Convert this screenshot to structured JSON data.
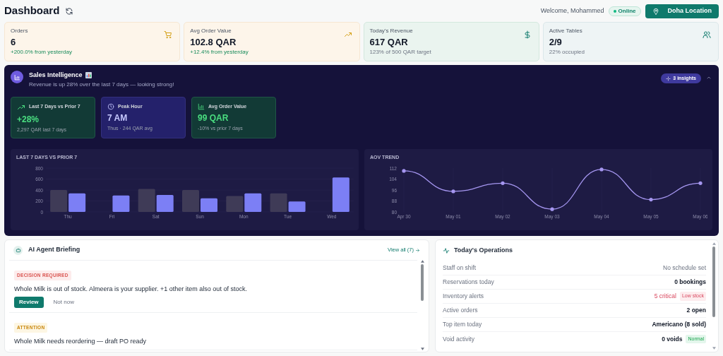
{
  "header": {
    "title": "Dashboard",
    "welcome": "Welcome, Mohammed",
    "status": {
      "label": "Online",
      "online": true
    },
    "location_button": "Doha Location"
  },
  "kpis": [
    {
      "label": "Orders",
      "value": "6",
      "note": "+200.0% from yesterday"
    },
    {
      "label": "Avg Order Value",
      "value": "102.8 QAR",
      "note": "+12.4% from yesterday"
    },
    {
      "label": "Today's Revenue",
      "value": "617 QAR",
      "note": "123% of 500 QAR target"
    },
    {
      "label": "Active Tables",
      "value": "2/9",
      "note": "22% occupied"
    }
  ],
  "sales_intelligence": {
    "title": "Sales Intelligence",
    "subtitle": "Revenue is up 28% over the last 7 days — looking strong!",
    "insights_badge": "3 insights",
    "expanded": true,
    "stats": [
      {
        "label": "Last 7 Days vs Prior 7",
        "value": "+28%",
        "note": "2,297 QAR last 7 days"
      },
      {
        "label": "Peak Hour",
        "value": "7 AM",
        "note": "Thus · 244 QAR avg"
      },
      {
        "label": "Avg Order Value",
        "value": "99 QAR",
        "note": "-10% vs prior 7 days"
      }
    ],
    "bar_chart": {
      "chart_data": {
        "type": "bar",
        "title": "LAST 7 DAYS VS PRIOR 7",
        "categories": [
          "Thu",
          "Fri",
          "Sat",
          "Sun",
          "Mon",
          "Tue",
          "Wed"
        ],
        "ylim": [
          0,
          800
        ],
        "yticks": [
          0,
          200,
          400,
          600,
          800
        ],
        "series": [
          {
            "color": "#3f3b57",
            "values": [
              400,
              null,
              420,
              400,
              290,
              340,
              null
            ]
          },
          {
            "color": "#7c7ff5",
            "values": [
              340,
              300,
              310,
              250,
              340,
              190,
              630
            ]
          }
        ]
      }
    },
    "line_chart": {
      "chart_data": {
        "type": "line",
        "title": "AOV TREND",
        "categories": [
          "Apr 30",
          "May 01",
          "May 02",
          "May 03",
          "May 04",
          "May 05",
          "May 06"
        ],
        "ylim": [
          80,
          112
        ],
        "yticks": [
          80,
          88,
          96,
          104,
          112
        ],
        "series": [
          {
            "color": "#a596f0",
            "values": [
              110,
              95,
              101,
              82,
              111,
              89,
              101
            ]
          }
        ]
      }
    }
  },
  "briefing": {
    "title": "AI Agent Briefing",
    "view_all": "View all (7)",
    "items": [
      {
        "tag": "DECISION REQUIRED",
        "kind": "decision",
        "text": "Whole Milk is out of stock. Almeera is your supplier. +1 other item also out of stock.",
        "primary": "Review",
        "secondary": "Not now"
      },
      {
        "tag": "ATTENTION",
        "kind": "attention",
        "text": "Whole Milk needs reordering — draft PO ready"
      }
    ]
  },
  "operations": {
    "title": "Today's Operations",
    "rows": [
      {
        "label": "Staff on shift",
        "value": "No schedule set",
        "kind": "muted"
      },
      {
        "label": "Reservations today",
        "value": "0 bookings",
        "kind": "normal"
      },
      {
        "label": "Inventory alerts",
        "value": "5 critical",
        "kind": "alert",
        "badge": {
          "text": "Low stock",
          "kind": "danger"
        }
      },
      {
        "label": "Active orders",
        "value": "2 open",
        "kind": "normal"
      },
      {
        "label": "Top item today",
        "value": "Americano (8 sold)",
        "kind": "normal"
      },
      {
        "label": "Void activity",
        "value": "0 voids",
        "kind": "normal",
        "badge": {
          "text": "Normal",
          "kind": "success"
        }
      }
    ]
  }
}
